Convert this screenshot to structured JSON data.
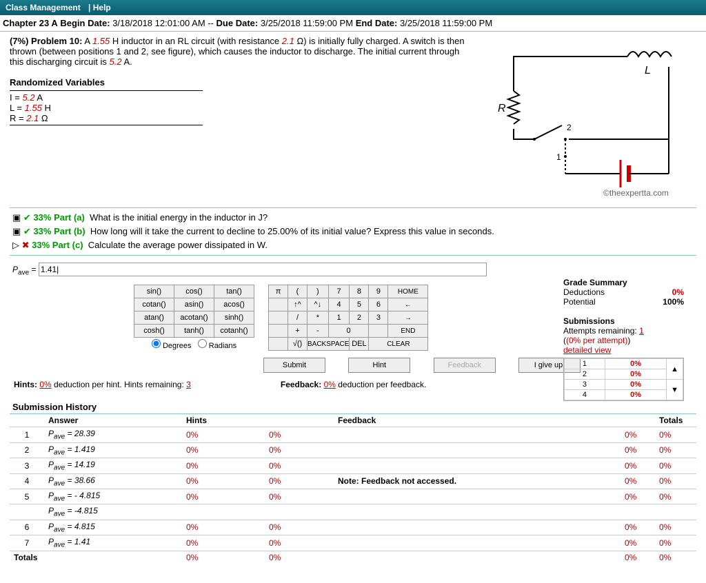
{
  "header": {
    "class_mgmt": "Class Management",
    "help": "Help"
  },
  "chapter": {
    "title": "Chapter 23 A",
    "begin_label": "Begin Date:",
    "begin": "3/18/2018 12:01:00 AM",
    "due_label": "Due Date:",
    "due": "3/25/2018 11:59:00 PM",
    "end_label": "End Date:",
    "end": "3/25/2018 11:59:00 PM"
  },
  "problem": {
    "pct": "(7%) Problem 10:",
    "text1": " A ",
    "L": "1.55",
    "text2": " H inductor in an RL circuit (with resistance ",
    "R": "2.1",
    "text3": " Ω) is initially fully charged. A switch is then thrown (between positions 1 and 2, see figure), which causes the inductor to discharge. The initial current through this discharging circuit is ",
    "I": "5.2",
    "text4": " A.",
    "rand_head": "Randomized Variables",
    "varI_l": "I = ",
    "varI": "5.2",
    "varI_u": " A",
    "varL_l": "L = ",
    "varL": "1.55",
    "varL_u": " H",
    "varR_l": "R = ",
    "varR": "2.1",
    "varR_u": " Ω",
    "copyright": "©theexpertta.com"
  },
  "parts": {
    "a_pct": "33% Part (a)",
    "a": "What is the initial energy in the inductor in J?",
    "b_pct": "33% Part (b)",
    "b": "How long will it take the current to decline to 25.00% of its initial value? Express this value in seconds.",
    "c_pct": "33% Part (c)",
    "c": "Calculate the average power dissipated in W."
  },
  "answer": {
    "var": "P",
    "sub": "ave",
    "eq": " = ",
    "value": "1.41|"
  },
  "keypad": {
    "funcs": [
      [
        "sin()",
        "cos()",
        "tan()"
      ],
      [
        "cotan()",
        "asin()",
        "acos()"
      ],
      [
        "atan()",
        "acotan()",
        "sinh()"
      ],
      [
        "cosh()",
        "tanh()",
        "cotanh()"
      ]
    ],
    "deg": "Degrees",
    "rad": "Radians",
    "nums": [
      [
        "π",
        "(",
        ")",
        "7",
        "8",
        "9",
        "HOME"
      ],
      [
        "",
        "↑^",
        "^↓",
        "4",
        "5",
        "6",
        "←"
      ],
      [
        "",
        "/",
        "*",
        "1",
        "2",
        "3",
        "→"
      ],
      [
        "",
        "+",
        "-",
        "0",
        "",
        "",
        "END"
      ],
      [
        "",
        "√()",
        "BACKSPACE",
        "",
        "DEL",
        "CLEAR",
        ""
      ]
    ]
  },
  "grade": {
    "title": "Grade Summary",
    "ded_l": "Deductions",
    "ded": "0%",
    "pot_l": "Potential",
    "pot": "100%",
    "sub_title": "Submissions",
    "att_l": "Attempts remaining:",
    "att": "1",
    "per": "(0% per attempt)",
    "dv": "detailed view",
    "rows": [
      [
        "1",
        "0%"
      ],
      [
        "2",
        "0%"
      ],
      [
        "3",
        "0%"
      ],
      [
        "4",
        "0%"
      ]
    ]
  },
  "actions": {
    "submit": "Submit",
    "hint": "Hint",
    "feedback": "Feedback",
    "giveup": "I give up!"
  },
  "hints": {
    "h1": "Hints: ",
    "h1u": "0%",
    "h2": " deduction per hint. Hints remaining: ",
    "h2u": "3",
    "f1": "Feedback: ",
    "f1u": "0%",
    "f2": " deduction per feedback."
  },
  "history": {
    "title": "Submission History",
    "cols": [
      "",
      "Answer",
      "Hints",
      "",
      "Feedback",
      "",
      "Totals"
    ],
    "rows": [
      {
        "n": "1",
        "ans": "Pave = 28.39",
        "h": "0%",
        "hc": "0%",
        "fb": "",
        "t1": "0%",
        "t2": "0%"
      },
      {
        "n": "2",
        "ans": "Pave = 1.419",
        "h": "0%",
        "hc": "0%",
        "fb": "",
        "t1": "0%",
        "t2": "0%"
      },
      {
        "n": "3",
        "ans": "Pave = 14.19",
        "h": "0%",
        "hc": "0%",
        "fb": "",
        "t1": "0%",
        "t2": "0%"
      },
      {
        "n": "4",
        "ans": "Pave = 38.66",
        "h": "0%",
        "hc": "0%",
        "fb": "Note: Feedback not accessed.",
        "t1": "0%",
        "t2": "0%"
      },
      {
        "n": "5",
        "ans": "Pave = - 4.815",
        "h": "0%",
        "hc": "0%",
        "fb": "",
        "t1": "0%",
        "t2": "0%"
      },
      {
        "n": "",
        "ans": "Pave = -4.815",
        "h": "",
        "hc": "",
        "fb": "",
        "t1": "",
        "t2": ""
      },
      {
        "n": "6",
        "ans": "Pave = 4.815",
        "h": "0%",
        "hc": "0%",
        "fb": "",
        "t1": "0%",
        "t2": "0%"
      },
      {
        "n": "7",
        "ans": "Pave = 1.41",
        "h": "0%",
        "hc": "0%",
        "fb": "",
        "t1": "0%",
        "t2": "0%"
      }
    ],
    "totals": {
      "l": "Totals",
      "h": "0%",
      "hc": "0%",
      "t1": "0%",
      "t2": "0%"
    }
  }
}
